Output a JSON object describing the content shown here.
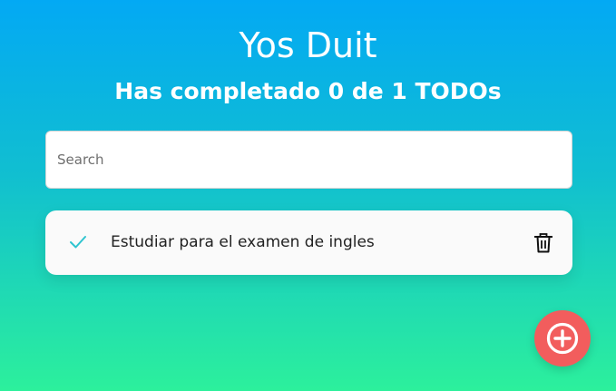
{
  "app": {
    "title": "Yos Duit",
    "counter": "Has completado 0 de 1 TODOs"
  },
  "search": {
    "placeholder": "Search",
    "value": ""
  },
  "todos": [
    {
      "text": "Estudiar para el examen de ingles",
      "completed": false,
      "check_icon": "check-icon",
      "delete_icon": "trash-icon"
    }
  ],
  "add_button": {
    "icon": "plus-circle-icon"
  },
  "colors": {
    "background_top": "#03a9f4",
    "background_bottom": "#2cf09c",
    "accent_check": "#2ec4cf",
    "add_button": "#f25d5d",
    "card": "#fafafa"
  }
}
